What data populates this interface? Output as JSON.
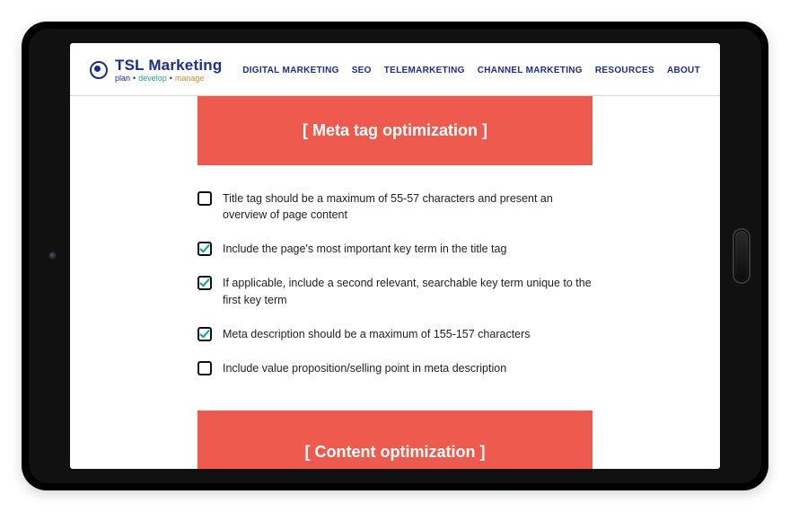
{
  "logo": {
    "title": "TSL Marketing",
    "tag1": "plan",
    "tag2": "develop",
    "tag3": "manage"
  },
  "nav": [
    "DIGITAL MARKETING",
    "SEO",
    "TELEMARKETING",
    "CHANNEL MARKETING",
    "RESOURCES",
    "ABOUT"
  ],
  "banner1": "[ Meta tag optimization ]",
  "banner2": "[ Content optimization ]",
  "checklist": [
    {
      "checked": false,
      "label": "Title tag should be a maximum of 55-57 characters and present an overview of page content"
    },
    {
      "checked": true,
      "label": "Include the page's most important key term in the title tag"
    },
    {
      "checked": true,
      "label": "If applicable, include a second relevant, searchable key term unique to the first key term"
    },
    {
      "checked": true,
      "label": "Meta description should be a maximum of 155-157 characters"
    },
    {
      "checked": false,
      "label": "Include value proposition/selling point in meta description"
    }
  ]
}
